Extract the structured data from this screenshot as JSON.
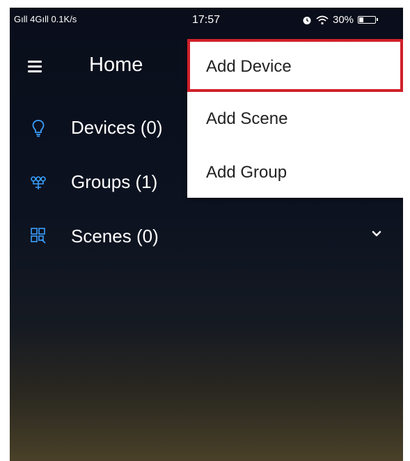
{
  "status_bar": {
    "signal": "Gıll 4Gıll 0.1K/s",
    "time": "17:57",
    "battery": "30%",
    "battery_level": 0.3
  },
  "app_bar": {
    "title": "Home"
  },
  "nav": {
    "devices": "Devices (0)",
    "groups": "Groups (1)",
    "scenes": "Scenes (0)"
  },
  "menu": {
    "add_device": "Add Device",
    "add_scene": "Add Scene",
    "add_group": "Add Group"
  },
  "colors": {
    "accent_icon": "#3aa0ff",
    "highlight": "#d0202a"
  }
}
